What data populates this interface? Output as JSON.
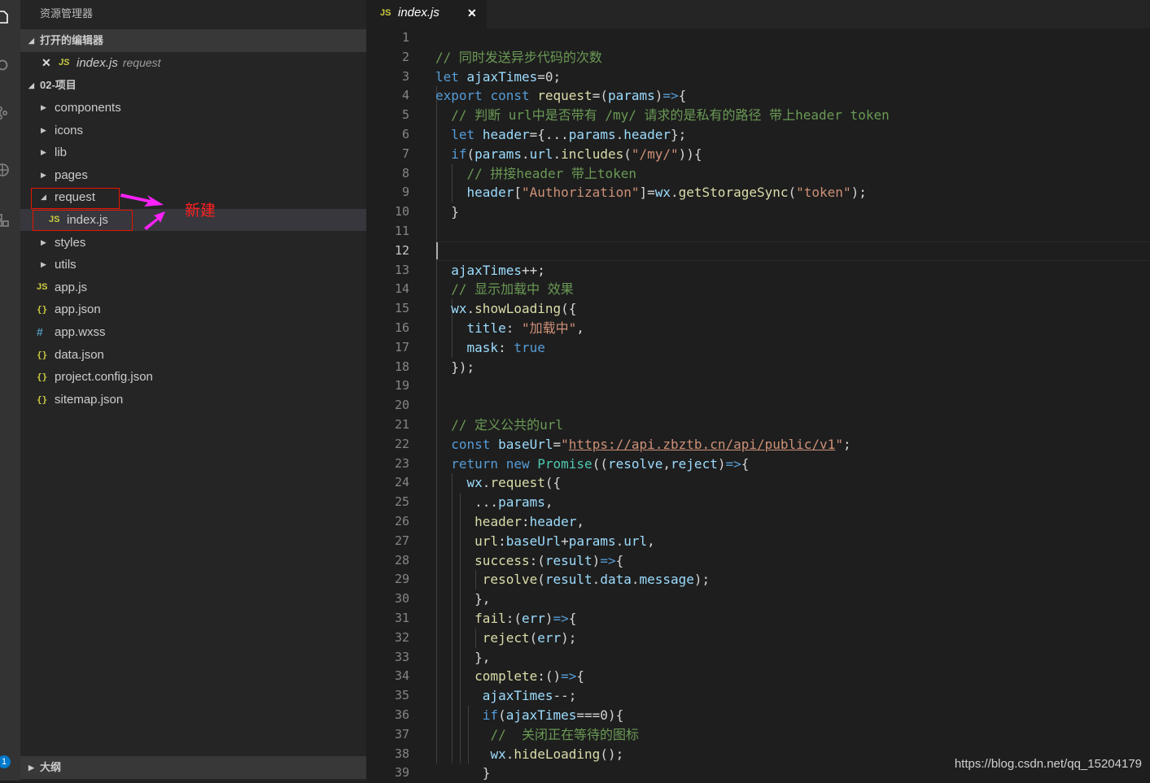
{
  "sidebar": {
    "title": "资源管理器",
    "open_editors": {
      "label": "打开的编辑器",
      "items": [
        {
          "icon": "JS",
          "name": "index.js",
          "desc": "request"
        }
      ]
    },
    "project": {
      "label": "02-项目",
      "tree": [
        {
          "name": "components",
          "type": "folder",
          "expanded": false
        },
        {
          "name": "icons",
          "type": "folder",
          "expanded": false
        },
        {
          "name": "lib",
          "type": "folder",
          "expanded": false
        },
        {
          "name": "pages",
          "type": "folder",
          "expanded": false
        },
        {
          "name": "request",
          "type": "folder",
          "expanded": true
        },
        {
          "name": "index.js",
          "type": "js",
          "child": true,
          "selected": true
        },
        {
          "name": "styles",
          "type": "folder",
          "expanded": false
        },
        {
          "name": "utils",
          "type": "folder",
          "expanded": false
        },
        {
          "name": "app.js",
          "type": "js"
        },
        {
          "name": "app.json",
          "type": "json"
        },
        {
          "name": "app.wxss",
          "type": "css"
        },
        {
          "name": "data.json",
          "type": "json"
        },
        {
          "name": "project.config.json",
          "type": "json"
        },
        {
          "name": "sitemap.json",
          "type": "json"
        }
      ]
    },
    "outline_label": "大纲",
    "annotation": "新建"
  },
  "icons": {
    "js": "JS",
    "json": "{}",
    "css": "#",
    "close": "✕",
    "collapsed": "▶",
    "expanded": "◢"
  },
  "activity": {
    "badge": "1"
  },
  "tab": {
    "icon": "JS",
    "name": "index.js",
    "close": "✕"
  },
  "editor": {
    "active_line": 12,
    "lines": [
      [],
      [
        [
          "c",
          "// 同时发送异步代码的次数"
        ]
      ],
      [
        [
          "k",
          "let"
        ],
        [
          "p",
          " "
        ],
        [
          "v",
          "ajaxTimes"
        ],
        [
          "p",
          "=0;"
        ]
      ],
      [
        [
          "k",
          "export"
        ],
        [
          "p",
          " "
        ],
        [
          "k",
          "const"
        ],
        [
          "p",
          " "
        ],
        [
          "f",
          "request"
        ],
        [
          "p",
          "=("
        ],
        [
          "v",
          "params"
        ],
        [
          "p",
          ")"
        ],
        [
          "k",
          "=>"
        ],
        [
          "p",
          "{"
        ]
      ],
      [
        [
          "p",
          "  "
        ],
        [
          "c",
          "// 判断 url中是否带有 /my/ 请求的是私有的路径 带上header token"
        ]
      ],
      [
        [
          "p",
          "  "
        ],
        [
          "k",
          "let"
        ],
        [
          "p",
          " "
        ],
        [
          "v",
          "header"
        ],
        [
          "p",
          "={..."
        ],
        [
          "v",
          "params"
        ],
        [
          "p",
          "."
        ],
        [
          "v",
          "header"
        ],
        [
          "p",
          "};"
        ]
      ],
      [
        [
          "p",
          "  "
        ],
        [
          "k",
          "if"
        ],
        [
          "p",
          "("
        ],
        [
          "v",
          "params"
        ],
        [
          "p",
          "."
        ],
        [
          "v",
          "url"
        ],
        [
          "p",
          "."
        ],
        [
          "f",
          "includes"
        ],
        [
          "p",
          "("
        ],
        [
          "s",
          "\"/my/\""
        ],
        [
          "p",
          "))"
        ],
        [
          "p",
          "{"
        ]
      ],
      [
        [
          "p",
          "    "
        ],
        [
          "c",
          "// 拼接header 带上token"
        ]
      ],
      [
        [
          "p",
          "    "
        ],
        [
          "v",
          "header"
        ],
        [
          "p",
          "["
        ],
        [
          "s",
          "\"Authorization\""
        ],
        [
          "p",
          "]="
        ],
        [
          "v",
          "wx"
        ],
        [
          "p",
          "."
        ],
        [
          "f",
          "getStorageSync"
        ],
        [
          "p",
          "("
        ],
        [
          "s",
          "\"token\""
        ],
        [
          "p",
          ");"
        ]
      ],
      [
        [
          "p",
          "  }"
        ]
      ],
      [],
      [],
      [
        [
          "p",
          "  "
        ],
        [
          "v",
          "ajaxTimes"
        ],
        [
          "p",
          "++;"
        ]
      ],
      [
        [
          "p",
          "  "
        ],
        [
          "c",
          "// 显示加载中 效果"
        ]
      ],
      [
        [
          "p",
          "  "
        ],
        [
          "v",
          "wx"
        ],
        [
          "p",
          "."
        ],
        [
          "f",
          "showLoading"
        ],
        [
          "p",
          "({"
        ]
      ],
      [
        [
          "p",
          "    "
        ],
        [
          "v",
          "title"
        ],
        [
          "p",
          ": "
        ],
        [
          "s",
          "\"加载中\""
        ],
        [
          "p",
          ","
        ]
      ],
      [
        [
          "p",
          "    "
        ],
        [
          "v",
          "mask"
        ],
        [
          "p",
          ": "
        ],
        [
          "k",
          "true"
        ]
      ],
      [
        [
          "p",
          "  });"
        ]
      ],
      [],
      [],
      [
        [
          "p",
          "  "
        ],
        [
          "c",
          "// 定义公共的url"
        ]
      ],
      [
        [
          "p",
          "  "
        ],
        [
          "k",
          "const"
        ],
        [
          "p",
          " "
        ],
        [
          "v",
          "baseUrl"
        ],
        [
          "p",
          "="
        ],
        [
          "s",
          "\""
        ],
        [
          "su",
          "https://api.zbztb.cn/api/public/v1"
        ],
        [
          "s",
          "\""
        ],
        [
          "p",
          ";"
        ]
      ],
      [
        [
          "p",
          "  "
        ],
        [
          "k",
          "return"
        ],
        [
          "p",
          " "
        ],
        [
          "k",
          "new"
        ],
        [
          "p",
          " "
        ],
        [
          "t",
          "Promise"
        ],
        [
          "p",
          "(("
        ],
        [
          "v",
          "resolve"
        ],
        [
          "p",
          ","
        ],
        [
          "v",
          "reject"
        ],
        [
          "p",
          ")"
        ],
        [
          "k",
          "=>"
        ],
        [
          "p",
          "{"
        ]
      ],
      [
        [
          "p",
          "    "
        ],
        [
          "v",
          "wx"
        ],
        [
          "p",
          "."
        ],
        [
          "f",
          "request"
        ],
        [
          "p",
          "({"
        ]
      ],
      [
        [
          "p",
          "     ..."
        ],
        [
          "v",
          "params"
        ],
        [
          "p",
          ","
        ]
      ],
      [
        [
          "p",
          "     "
        ],
        [
          "f",
          "header"
        ],
        [
          "p",
          ":"
        ],
        [
          "v",
          "header"
        ],
        [
          "p",
          ","
        ]
      ],
      [
        [
          "p",
          "     "
        ],
        [
          "f",
          "url"
        ],
        [
          "p",
          ":"
        ],
        [
          "v",
          "baseUrl"
        ],
        [
          "p",
          "+"
        ],
        [
          "v",
          "params"
        ],
        [
          "p",
          "."
        ],
        [
          "v",
          "url"
        ],
        [
          "p",
          ","
        ]
      ],
      [
        [
          "p",
          "     "
        ],
        [
          "f",
          "success"
        ],
        [
          "p",
          ":("
        ],
        [
          "v",
          "result"
        ],
        [
          "p",
          ")"
        ],
        [
          "k",
          "=>"
        ],
        [
          "p",
          "{"
        ]
      ],
      [
        [
          "p",
          "      "
        ],
        [
          "f",
          "resolve"
        ],
        [
          "p",
          "("
        ],
        [
          "v",
          "result"
        ],
        [
          "p",
          "."
        ],
        [
          "v",
          "data"
        ],
        [
          "p",
          "."
        ],
        [
          "v",
          "message"
        ],
        [
          "p",
          ");"
        ]
      ],
      [
        [
          "p",
          "     },"
        ]
      ],
      [
        [
          "p",
          "     "
        ],
        [
          "f",
          "fail"
        ],
        [
          "p",
          ":("
        ],
        [
          "v",
          "err"
        ],
        [
          "p",
          ")"
        ],
        [
          "k",
          "=>"
        ],
        [
          "p",
          "{"
        ]
      ],
      [
        [
          "p",
          "      "
        ],
        [
          "f",
          "reject"
        ],
        [
          "p",
          "("
        ],
        [
          "v",
          "err"
        ],
        [
          "p",
          ");"
        ]
      ],
      [
        [
          "p",
          "     },"
        ]
      ],
      [
        [
          "p",
          "     "
        ],
        [
          "f",
          "complete"
        ],
        [
          "p",
          ":()"
        ],
        [
          "k",
          "=>"
        ],
        [
          "p",
          "{"
        ]
      ],
      [
        [
          "p",
          "      "
        ],
        [
          "v",
          "ajaxTimes"
        ],
        [
          "p",
          "--;"
        ]
      ],
      [
        [
          "p",
          "      "
        ],
        [
          "k",
          "if"
        ],
        [
          "p",
          "("
        ],
        [
          "v",
          "ajaxTimes"
        ],
        [
          "p",
          "===0){"
        ]
      ],
      [
        [
          "p",
          "       "
        ],
        [
          "c",
          "//  关闭正在等待的图标"
        ]
      ],
      [
        [
          "p",
          "       "
        ],
        [
          "v",
          "wx"
        ],
        [
          "p",
          "."
        ],
        [
          "f",
          "hideLoading"
        ],
        [
          "p",
          "();"
        ]
      ],
      [
        [
          "p",
          "      }"
        ]
      ]
    ]
  },
  "watermark": "https://blog.csdn.net/qq_15204179"
}
